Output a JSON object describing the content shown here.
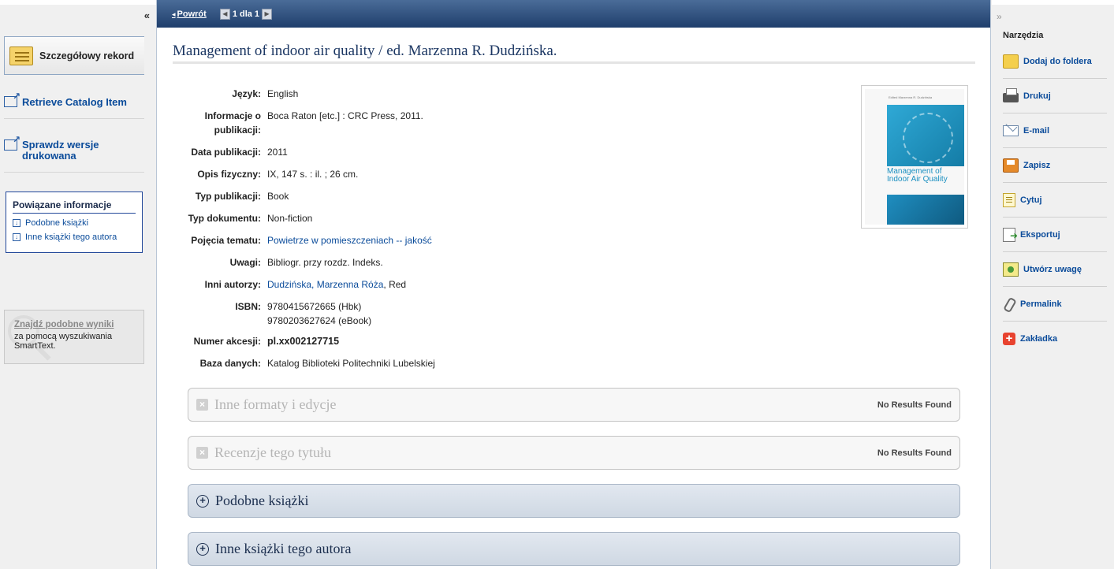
{
  "left": {
    "collapse": "«",
    "detail_label": "Szczegółowy rekord",
    "links": [
      "Retrieve Catalog Item",
      "Sprawdz wersje drukowana"
    ],
    "related": {
      "title": "Powiązane informacje",
      "items": [
        "Podobne książki",
        "Inne książki tego autora"
      ]
    },
    "smart": {
      "title": "Znajdź podobne wyniki",
      "desc": "za pomocą wyszukiwania SmartText."
    }
  },
  "topbar": {
    "back": "Powrót",
    "pager": "1 dla 1"
  },
  "record": {
    "title": "Management of indoor air quality / ed. Marzenna R. Dudzińska.",
    "fields": [
      {
        "label": "Język:",
        "value": "English"
      },
      {
        "label": "Informacje o publikacji:",
        "value": "Boca Raton [etc.] : CRC Press, 2011."
      },
      {
        "label": "Data publikacji:",
        "value": "2011"
      },
      {
        "label": "Opis fizyczny:",
        "value": "IX, 147 s. : il. ; 26 cm."
      },
      {
        "label": "Typ publikacji:",
        "value": "Book"
      },
      {
        "label": "Typ dokumentu:",
        "value": "Non-fiction"
      },
      {
        "label": "Pojęcia tematu:",
        "value": "Powietrze w pomieszczeniach -- jakość"
      },
      {
        "label": "Uwagi:",
        "value": "Bibliogr. przy rozdz. Indeks."
      },
      {
        "label": "Inni autorzy:",
        "value": "Dudzińska, Marzenna Róża",
        "suffix": ", Red"
      },
      {
        "label": "ISBN:",
        "value": "9780415672665 (Hbk)",
        "value2": "9780203627624 (eBook)"
      },
      {
        "label": "Numer akcesji:",
        "value": "pl.xx002127715"
      },
      {
        "label": "Baza danych:",
        "value": "Katalog Biblioteki Politechniki Lubelskiej"
      }
    ],
    "cover": {
      "editor": "Edited Marzenna R. Dudzińska",
      "title": "Management of Indoor Air Quality"
    }
  },
  "panels": [
    {
      "title": "Inne formaty i edycje",
      "status": "No Results Found"
    },
    {
      "title": "Recenzje tego tytułu",
      "status": "No Results Found"
    },
    {
      "title": "Podobne książki"
    },
    {
      "title": "Inne książki tego autora"
    }
  ],
  "right": {
    "expand": "»",
    "header": "Narzędzia",
    "tools": [
      "Dodaj do foldera",
      "Drukuj",
      "E-mail",
      "Zapisz",
      "Cytuj",
      "Eksportuj",
      "Utwórz uwagę",
      "Permalink",
      "Zakładka"
    ]
  }
}
